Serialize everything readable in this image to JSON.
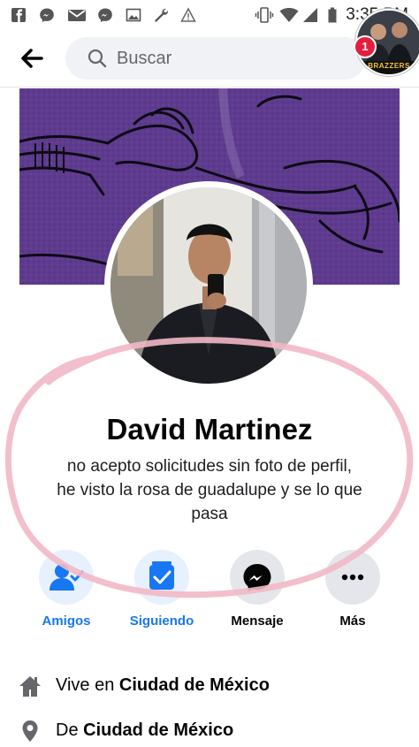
{
  "status_bar": {
    "time": "3:35 PM",
    "icons": [
      "facebook-icon",
      "messenger-icon",
      "gmail-icon",
      "messenger-icon",
      "gallery-icon",
      "wrench-icon",
      "warning-icon",
      "vibrate-icon",
      "wifi-icon",
      "signal-icon",
      "battery-icon"
    ]
  },
  "topnav": {
    "search_placeholder": "Buscar",
    "notification_count": "1",
    "story_thumb_text": "BRAZZERS"
  },
  "profile": {
    "name": "David Martinez",
    "bio_line1": "no acepto solicitudes sin foto de perfil,",
    "bio_line2": "he visto la rosa de guadalupe y se lo que",
    "bio_line3": "pasa"
  },
  "actions": [
    {
      "label": "Amigos",
      "icon": "friends-icon",
      "color": "#1877f2"
    },
    {
      "label": "Siguiendo",
      "icon": "following-icon",
      "color": "#1877f2"
    },
    {
      "label": "Mensaje",
      "icon": "messenger-icon",
      "color": "#050505"
    },
    {
      "label": "Más",
      "icon": "more-icon",
      "color": "#050505"
    }
  ],
  "info": {
    "lives_prefix": "Vive en ",
    "lives_city": "Ciudad de México",
    "from_prefix": "De ",
    "from_city": "Ciudad de México"
  },
  "colors": {
    "accent": "#1877f2",
    "cover": "#5e3b8e",
    "annotation": "#f2b8c6"
  }
}
